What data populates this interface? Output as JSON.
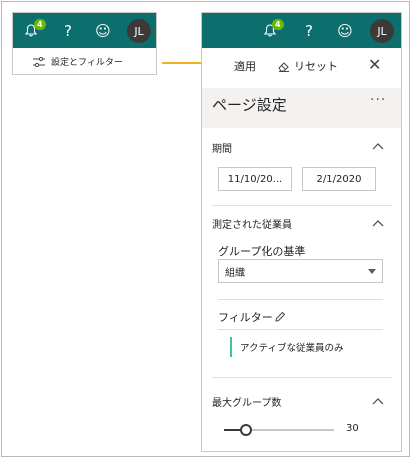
{
  "topbar": {
    "notification_count": "4",
    "help_label": "?",
    "feedback_label": "☺",
    "avatar_initials": "JL"
  },
  "mini_panel": {
    "settings_button_label": "設定とフィルター"
  },
  "panel": {
    "apply_label": "適用",
    "reset_label": "リセット",
    "close_label": "✕",
    "page_title": "ページ設定",
    "more_label": "···",
    "period": {
      "title": "期間",
      "start_date": "11/10/20...",
      "end_date": "2/1/2020"
    },
    "measured": {
      "title": "測定された従業員",
      "group_by_label": "グループ化の基準",
      "group_by_value": "組織",
      "filter_label": "フィルター",
      "filter_item": "アクティブな従業員のみ"
    },
    "max_groups": {
      "title": "最大グループ数",
      "slider_value": "30",
      "slider_fraction": 0.2
    }
  },
  "colors": {
    "topbar": "#0d6e6e",
    "badge": "#6bb700",
    "arrow": "#f2b01e",
    "filter_accent": "#3ec4a0"
  }
}
